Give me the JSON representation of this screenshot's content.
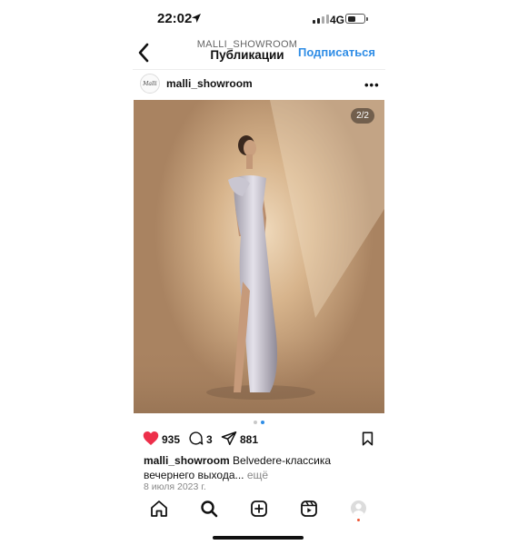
{
  "status_bar": {
    "time": "22:02",
    "network": "4G",
    "battery_level": 0.5
  },
  "header": {
    "username": "MALLI_SHOWROOM",
    "title": "Публикации",
    "subscribe_label": "Подписаться"
  },
  "post": {
    "avatar_text": "Malli",
    "username": "malli_showroom",
    "image_counter": "2/2",
    "carousel": {
      "count": 2,
      "active_index": 1
    },
    "likes": "935",
    "comments": "3",
    "shares": "881",
    "caption_user": "malli_showroom",
    "caption_text": "Belvedere-классика вечернего выхода...",
    "caption_more": "ещё",
    "date": "8 июля 2023 г."
  },
  "colors": {
    "accent": "#2f8de6",
    "like": "#ed2f4a",
    "dot_active": "#2f8de6",
    "dot_inactive": "#c8c8c8"
  },
  "tab_bar": [
    "home-icon",
    "search-icon",
    "create-icon",
    "reels-icon",
    "profile-avatar"
  ]
}
